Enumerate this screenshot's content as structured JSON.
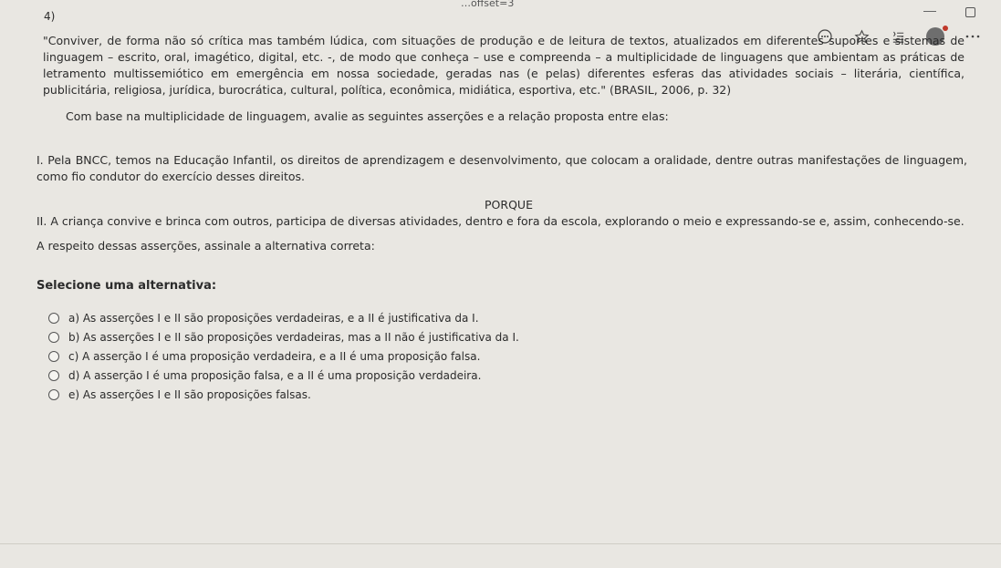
{
  "browser": {
    "url_fragment": "…offset=3",
    "toolbar_icons": [
      "more-actions-icon",
      "favorite-star-icon",
      "reading-list-icon",
      "profile-avatar",
      "settings-more-icon"
    ]
  },
  "question": {
    "number": "4)",
    "quote": "\"Conviver, de forma não só crítica mas também lúdica, com situações de produção e de leitura de textos, atualizados em diferentes suportes e sistemas de linguagem – escrito, oral, imagético, digital, etc. -, de modo que conheça – use e compreenda – a multiplicidade de linguagens que ambientam as práticas de letramento multissemiótico em emergência em nossa sociedade, geradas nas (e pelas) diferentes esferas das atividades sociais – literária, científica, publicitária, religiosa, jurídica, burocrática, cultural, política, econômica, midiática, esportiva, etc.\" (BRASIL, 2006, p. 32)",
    "prompt": "Com base na multiplicidade de linguagem, avalie as seguintes asserções e a relação proposta entre elas:",
    "assertion_1": "I. Pela BNCC, temos na Educação Infantil, os direitos de aprendizagem e desenvolvimento, que colocam a oralidade, dentre outras manifestações de linguagem, como fio condutor do exercício desses direitos.",
    "connector": "PORQUE",
    "assertion_2": "II. A criança convive e brinca com outros, participa de diversas atividades, dentro e fora da escola, explorando o meio e expressando-se e, assim, conhecendo-se.",
    "respect_text": "A respeito dessas asserções, assinale a alternativa correta:",
    "select_label": "Selecione uma alternativa:",
    "options": [
      {
        "label": "a) As asserções I e II são proposições verdadeiras, e a II é justificativa da I."
      },
      {
        "label": "b) As asserções I e II são proposições verdadeiras, mas a II não é justificativa da I."
      },
      {
        "label": "c) A asserção I é uma proposição verdadeira, e a II é uma proposição falsa."
      },
      {
        "label": "d) A asserção I é uma proposição falsa, e a II é uma proposição verdadeira."
      },
      {
        "label": "e) As asserções I e II são proposições falsas."
      }
    ]
  }
}
